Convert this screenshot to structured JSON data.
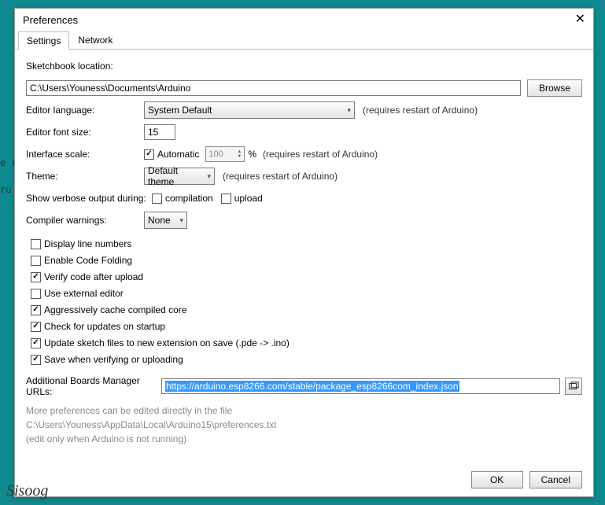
{
  "window": {
    "title": "Preferences"
  },
  "tabs": {
    "settings": "Settings",
    "network": "Network"
  },
  "sketchbook": {
    "label": "Sketchbook location:",
    "value": "C:\\Users\\Youness\\Documents\\Arduino",
    "browse": "Browse"
  },
  "editorLanguage": {
    "label": "Editor language:",
    "value": "System Default",
    "note": "(requires restart of Arduino)"
  },
  "editorFontSize": {
    "label": "Editor font size:",
    "value": "15"
  },
  "interfaceScale": {
    "label": "Interface scale:",
    "automatic": "Automatic",
    "value": "100",
    "percent": "%",
    "note": "(requires restart of Arduino)"
  },
  "theme": {
    "label": "Theme:",
    "value": "Default theme",
    "note": "(requires restart of Arduino)"
  },
  "verbose": {
    "label": "Show verbose output during:",
    "compilation": "compilation",
    "upload": "upload"
  },
  "compilerWarnings": {
    "label": "Compiler warnings:",
    "value": "None"
  },
  "checks": {
    "displayLineNumbers": "Display line numbers",
    "enableCodeFolding": "Enable Code Folding",
    "verifyAfterUpload": "Verify code after upload",
    "useExternalEditor": "Use external editor",
    "aggressiveCache": "Aggressively cache compiled core",
    "checkUpdates": "Check for updates on startup",
    "updateExtension": "Update sketch files to new extension on save (.pde -> .ino)",
    "saveVerify": "Save when verifying or uploading"
  },
  "boardsUrls": {
    "label": "Additional Boards Manager URLs:",
    "value": "https://arduino.esp8266.com/stable/package_esp8266com_index.json"
  },
  "moreInfo": {
    "line1": "More preferences can be edited directly in the file",
    "line2": "C:\\Users\\Youness\\AppData\\Local\\Arduino15\\preferences.txt",
    "line3": "(edit only when Arduino is not running)"
  },
  "buttons": {
    "ok": "OK",
    "cancel": "Cancel"
  },
  "watermark": "Sisoog",
  "bgcode": {
    "a": "e r",
    "b": "ru"
  }
}
